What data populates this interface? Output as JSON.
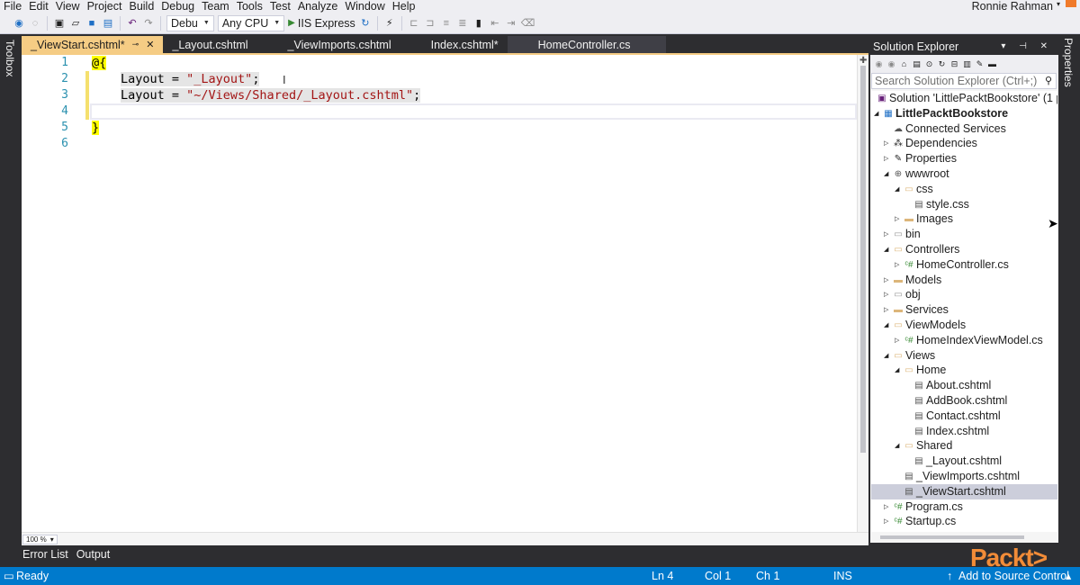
{
  "menu": [
    "File",
    "Edit",
    "View",
    "Project",
    "Build",
    "Debug",
    "Team",
    "Tools",
    "Test",
    "Analyze",
    "Window",
    "Help"
  ],
  "user": "Ronnie Rahman",
  "toolbar": {
    "config": "Debu",
    "platform": "Any CPU",
    "run_label": "IIS Express"
  },
  "side_labels": {
    "left": "Toolbox",
    "right": "Properties"
  },
  "tabs": [
    {
      "label": "_ViewStart.cshtml*"
    },
    {
      "label": "_Layout.cshtml"
    },
    {
      "label": "_ViewImports.cshtml"
    },
    {
      "label": "Index.cshtml*"
    },
    {
      "label": "HomeController.cs"
    }
  ],
  "editor": {
    "line_numbers": [
      "1",
      "2",
      "3",
      "4",
      "5",
      "6"
    ],
    "lines": {
      "l1_razor": "@{",
      "l2_key": "Layout = ",
      "l2_str": "\"_Layout\"",
      "l2_end": ";",
      "l3_key": "Layout = ",
      "l3_str": "\"~/Views/Shared/_Layout.cshtml\"",
      "l3_end": ";",
      "l5_razor": "}"
    },
    "zoom": "100 %"
  },
  "bottom_tabs": [
    "Error List",
    "Output"
  ],
  "status": {
    "ready": "Ready",
    "ln": "Ln 4",
    "col": "Col 1",
    "ch": "Ch 1",
    "mode": "INS",
    "source_control": "Add to Source Control"
  },
  "solution_explorer": {
    "title": "Solution Explorer",
    "search_placeholder": "Search Solution Explorer (Ctrl+;)",
    "nodes": [
      "Solution 'LittlePacktBookstore' (1 pr",
      "LittlePacktBookstore",
      "Connected Services",
      "Dependencies",
      "Properties",
      "wwwroot",
      "css",
      "style.css",
      "Images",
      "bin",
      "Controllers",
      "HomeController.cs",
      "Models",
      "obj",
      "Services",
      "ViewModels",
      "HomeIndexViewModel.cs",
      "Views",
      "Home",
      "About.cshtml",
      "AddBook.cshtml",
      "Contact.cshtml",
      "Index.cshtml",
      "Shared",
      "_Layout.cshtml",
      "_ViewImports.cshtml",
      "_ViewStart.cshtml",
      "Program.cs",
      "Startup.cs"
    ]
  },
  "watermark": "Packt>",
  "colors": {
    "accent_tab": "#f5cc84",
    "status_bar": "#007acc",
    "string": "#a31515",
    "line_number": "#2b91af",
    "razor_highlight": "#ffff00"
  }
}
